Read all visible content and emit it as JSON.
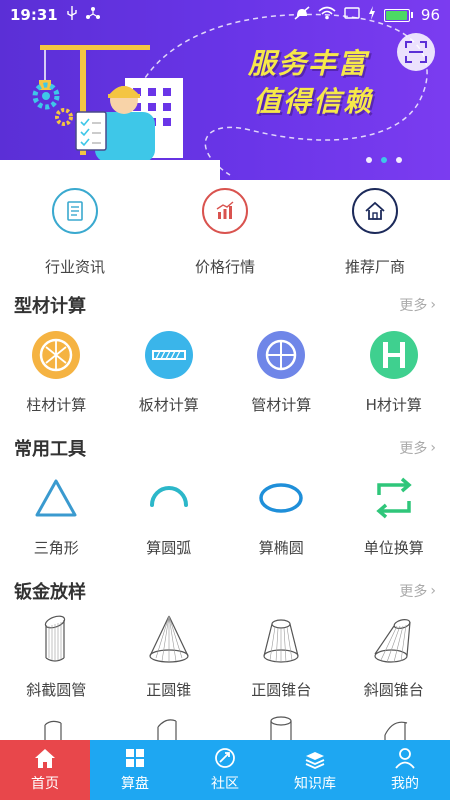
{
  "status_bar": {
    "time": "19:31",
    "battery_level": "96",
    "battery_fraction": 0.96
  },
  "banner": {
    "slogan_line1": "服务丰富",
    "slogan_line2": "值得信赖",
    "page_count": 3,
    "active_page": 1
  },
  "quick_nav": [
    {
      "label": "行业资讯",
      "icon": "news-icon",
      "color": "#3aa9cf"
    },
    {
      "label": "价格行情",
      "icon": "price-chart-icon",
      "color": "#d9534f"
    },
    {
      "label": "推荐厂商",
      "icon": "house-icon",
      "color": "#1c2a5a"
    }
  ],
  "sections": [
    {
      "title": "型材计算",
      "more": "更多",
      "items": [
        {
          "label": "柱材计算",
          "icon": "column-material-icon"
        },
        {
          "label": "板材计算",
          "icon": "plate-material-icon"
        },
        {
          "label": "管材计算",
          "icon": "pipe-material-icon"
        },
        {
          "label": "H材计算",
          "icon": "h-beam-icon"
        }
      ]
    },
    {
      "title": "常用工具",
      "more": "更多",
      "items": [
        {
          "label": "三角形",
          "icon": "triangle-icon"
        },
        {
          "label": "算圆弧",
          "icon": "arc-icon"
        },
        {
          "label": "算椭圆",
          "icon": "ellipse-icon"
        },
        {
          "label": "单位换算",
          "icon": "unit-convert-icon"
        }
      ]
    },
    {
      "title": "钣金放样",
      "more": "更多",
      "items": [
        {
          "label": "斜截圆管",
          "icon": "oblique-pipe-icon"
        },
        {
          "label": "正圆锥",
          "icon": "cone-icon"
        },
        {
          "label": "正圆锥台",
          "icon": "frustum-icon"
        },
        {
          "label": "斜圆锥台",
          "icon": "oblique-frustum-icon"
        }
      ]
    }
  ],
  "tab_bar": [
    {
      "label": "首页",
      "icon": "home-icon",
      "active": true
    },
    {
      "label": "算盘",
      "icon": "grid-icon",
      "active": false
    },
    {
      "label": "社区",
      "icon": "community-icon",
      "active": false
    },
    {
      "label": "知识库",
      "icon": "books-icon",
      "active": false
    },
    {
      "label": "我的",
      "icon": "user-icon",
      "active": false
    }
  ]
}
